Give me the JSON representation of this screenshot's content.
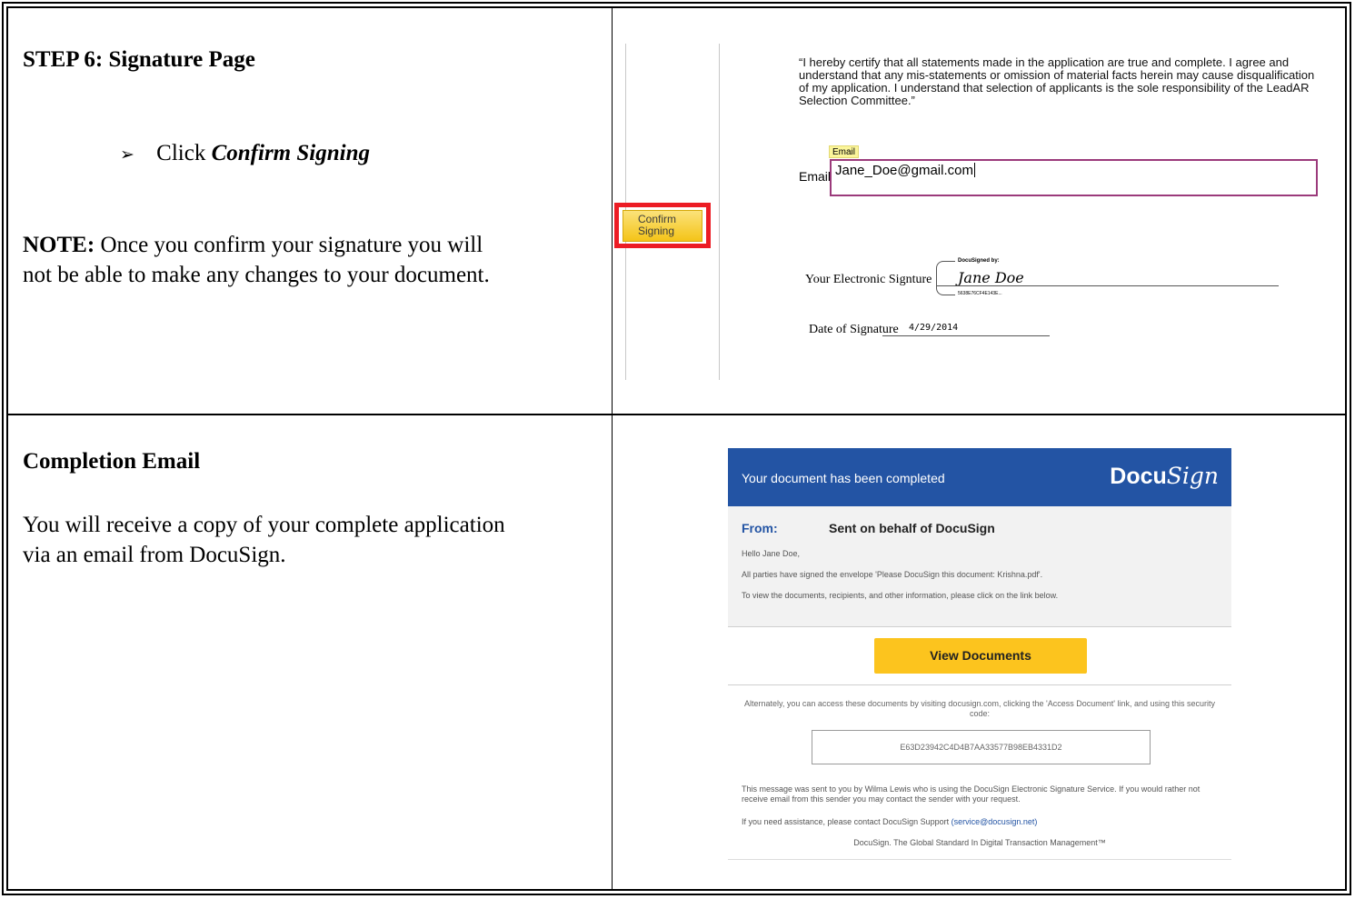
{
  "step6": {
    "heading": "STEP 6: Signature Page",
    "bullet_marker": "➢",
    "bullet_prefix": "Click ",
    "bullet_action": "Confirm Signing",
    "note_label": "NOTE:",
    "note_line1": " Once you confirm your signature you will",
    "note_line2": "not be able to make any changes to your document."
  },
  "signature_page": {
    "certification_text": "“I hereby certify that all statements made in the application are true and complete.  I agree and understand that any mis-statements or omission of material facts herein may cause disqualification of my application.  I understand that selection of applicants is the sole responsibility of the LeadAR Selection Committee.”",
    "email_tag": "Email",
    "email_label": "Email",
    "email_value": "Jane_Doe@gmail.com",
    "confirm_line1": "Confirm",
    "confirm_line2": "Signing",
    "signature_label": "Your Electronic Signture",
    "docusigned_caption": "DocuSigned by:",
    "signature_name": "Jane Doe",
    "signature_id": "5638E76CF4E143E...",
    "date_label": "Date of Signature",
    "date_value": "4/29/2014"
  },
  "completion": {
    "heading": "Completion Email",
    "line1": "You will receive a copy of your complete application",
    "line2": "via an email from DocuSign."
  },
  "email": {
    "banner_title": "Your document has been completed",
    "logo_text": "Docu",
    "logo_script": "Sign",
    "from_label": "From:",
    "from_value": "Sent on behalf of DocuSign",
    "greeting": "Hello Jane Doe,",
    "line_signed": "All parties have signed the envelope 'Please DocuSign this document: Krishna.pdf'.",
    "line_view": "To view the documents, recipients, and other information, please click on the link below.",
    "view_button": "View Documents",
    "alternate_text": "Alternately, you can access these documents by visiting docusign.com, clicking the 'Access Document' link, and using this security code:",
    "security_code": "E63D23942C4D4B7AA33577B98EB4331D2",
    "message_text": "This message was sent to you by Wilma Lewis who is using the DocuSign Electronic Signature Service. If you would rather not receive email from this sender you may contact the sender with your request.",
    "assist_text": "If you need assistance, please contact DocuSign Support ",
    "assist_link": "(service@docusign.net)",
    "tagline": "DocuSign. The Global Standard In Digital Transaction Management™"
  }
}
